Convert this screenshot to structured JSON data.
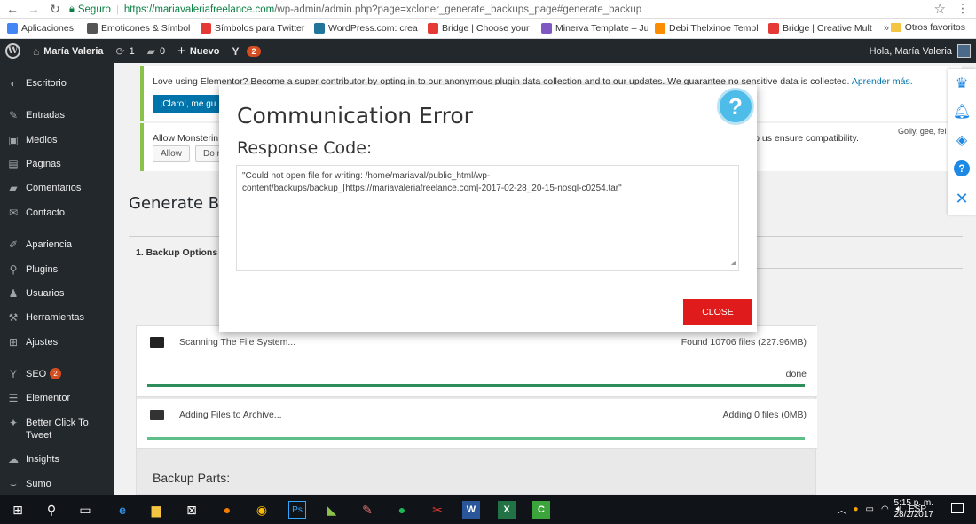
{
  "browser": {
    "secure_label": "Seguro",
    "url_host": "https://mariavaleriafreelance.com",
    "url_path": "/wp-admin/admin.php?page=xcloner_generate_backups_page#generate_backup",
    "bookmarks": [
      {
        "label": "Aplicaciones",
        "color": "#4285f4"
      },
      {
        "label": "Emoticones & Símbol",
        "color": "#555555"
      },
      {
        "label": "Símbolos para Twitter",
        "color": "#e53935"
      },
      {
        "label": "WordPress.com: crea",
        "color": "#21759b"
      },
      {
        "label": "Bridge | Choose your",
        "color": "#e53935"
      },
      {
        "label": "Minerva Template – Ju",
        "color": "#7e57c2"
      },
      {
        "label": "Debi Thelxinoe Templ",
        "color": "#fb8c00"
      },
      {
        "label": "Bridge | Creative Mult",
        "color": "#e53935"
      }
    ],
    "bookmarks_more": "»",
    "other_bookmarks": "Otros favoritos"
  },
  "adminbar": {
    "site_name": "María Valeria",
    "updates_count": "1",
    "comments_count": "0",
    "new_label": "Nuevo",
    "yoast_count": "2",
    "greeting": "Hola, María Valeria"
  },
  "sidebar": {
    "items": [
      {
        "label": "Escritorio",
        "icon": "dashboard-icon",
        "glyph": "◐"
      },
      {
        "label": "Entradas",
        "icon": "pin-icon",
        "glyph": "✎"
      },
      {
        "label": "Medios",
        "icon": "media-icon",
        "glyph": "▣"
      },
      {
        "label": "Páginas",
        "icon": "pages-icon",
        "glyph": "▤"
      },
      {
        "label": "Comentarios",
        "icon": "comments-icon",
        "glyph": "▰"
      },
      {
        "label": "Contacto",
        "icon": "mail-icon",
        "glyph": "✉"
      },
      {
        "label": "Apariencia",
        "icon": "appearance-icon",
        "glyph": "✐"
      },
      {
        "label": "Plugins",
        "icon": "plugins-icon",
        "glyph": "⚲"
      },
      {
        "label": "Usuarios",
        "icon": "users-icon",
        "glyph": "♟"
      },
      {
        "label": "Herramientas",
        "icon": "tools-icon",
        "glyph": "⚒"
      },
      {
        "label": "Ajustes",
        "icon": "settings-icon",
        "glyph": "⊞"
      },
      {
        "label": "SEO",
        "icon": "yoast-icon",
        "glyph": "Y",
        "badge": "2"
      },
      {
        "label": "Elementor",
        "icon": "elementor-icon",
        "glyph": "☰"
      },
      {
        "label": "Better Click To Tweet",
        "icon": "twitter-icon",
        "glyph": "✦"
      },
      {
        "label": "Insights",
        "icon": "insights-icon",
        "glyph": "☁"
      },
      {
        "label": "Sumo",
        "icon": "sumo-icon",
        "glyph": "⌣"
      }
    ]
  },
  "notices": {
    "elementor_text": "Love using Elementor? Become a super contributor by opting in to our anonymous plugin data collection and to our updates. We guarantee no sensitive data is collected.",
    "elementor_link": "Aprender más.",
    "elementor_button": "¡Claro!, me gu",
    "monster_text": "Allow Monsterin",
    "monster_text_right": "elp us ensure compatibility.",
    "monster_side": "Golly, gee, fel",
    "allow_button": "Allow",
    "deny_button": "Do n"
  },
  "page": {
    "title": "Generate Bac",
    "tab_label": "1. Backup Options"
  },
  "progress": {
    "rows": [
      {
        "label": "Scanning The File System...",
        "status": "Found 10706 files (227.96MB)",
        "done": "done",
        "pct": 100
      },
      {
        "label": "Adding Files to Archive...",
        "status": "Adding 0 files (0MB)",
        "done": "",
        "pct": 100
      }
    ],
    "parts_title": "Backup Parts:"
  },
  "modal": {
    "title": "Communication Error",
    "subtitle": "Response Code:",
    "message": "\"Could not open file for writing: /home/mariaval/public_html/wp-content/backups/backup_[https://mariavaleriafreelance.com]-2017-02-28_20-15-nosql-c0254.tar\"",
    "close_label": "CLOSE",
    "help_glyph": "?"
  },
  "right_toolbar": [
    "crown-icon",
    "bell-icon",
    "diamond-icon",
    "help-icon",
    "close-icon"
  ],
  "taskbar": {
    "language": "ESP",
    "time": "5:15 p. m.",
    "date": "28/2/2017"
  },
  "colors": {
    "accent_green": "#8bc34a",
    "wp_blue": "#0073aa",
    "close_red": "#e01b1b",
    "help_blue": "#4dbce9",
    "progress_green": "#2d8e5b"
  }
}
